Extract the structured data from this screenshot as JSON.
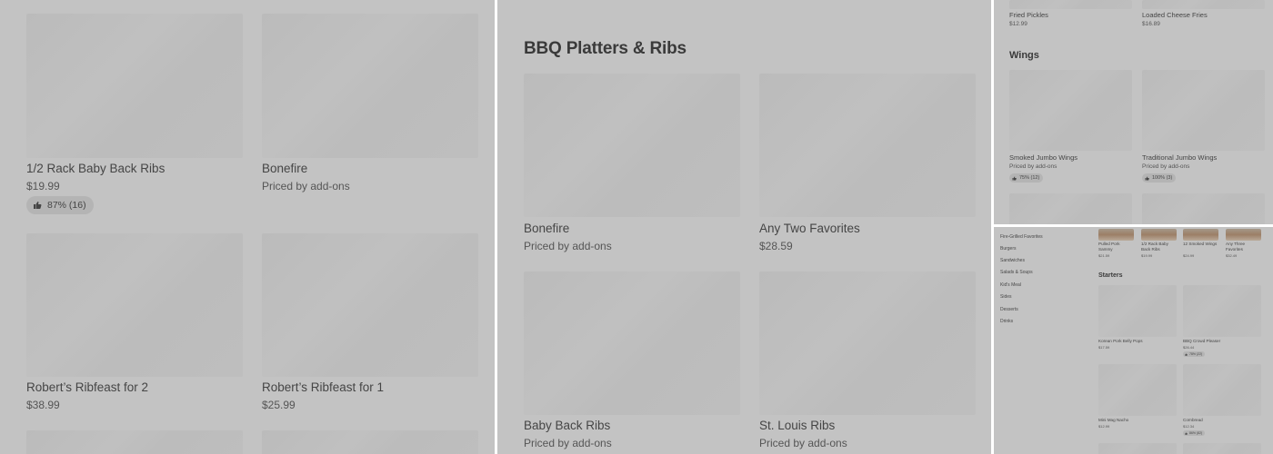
{
  "colors": {
    "background": "#c3c3c3",
    "card": "#bdbdbd",
    "badge": "#b4b4b4",
    "text": "#454545"
  },
  "icons": {
    "rating": "thumbs-up-icon"
  },
  "panel1": {
    "items": [
      {
        "name": "1/2 Rack Baby Back Ribs",
        "price": "$19.99",
        "rating": "87% (16)"
      },
      {
        "name": "Bonefire",
        "price": "Priced by add-ons"
      },
      {
        "name": "Robert’s Ribfeast for 2",
        "price": "$38.99"
      },
      {
        "name": "Robert’s Ribfeast for 1",
        "price": "$25.99"
      }
    ]
  },
  "panel2": {
    "section_title": "BBQ Platters & Ribs",
    "items": [
      {
        "name": "Bonefire",
        "price": "Priced by add-ons"
      },
      {
        "name": "Any Two Favorites",
        "price": "$28.59"
      },
      {
        "name": "Baby Back Ribs",
        "price": "Priced by add-ons"
      },
      {
        "name": "St. Louis Ribs",
        "price": "Priced by add-ons"
      }
    ]
  },
  "panel3": {
    "top_items": [
      {
        "name": "Fried Pickles",
        "price": "$12.99"
      },
      {
        "name": "Loaded Cheese Fries",
        "price": "$16.89"
      }
    ],
    "section_title": "Wings",
    "items": [
      {
        "name": "Smoked Jumbo Wings",
        "price": "Priced by add-ons",
        "rating": "75% (12)"
      },
      {
        "name": "Traditional Jumbo Wings",
        "price": "Priced by add-ons",
        "rating": "100% (3)"
      }
    ]
  },
  "panel4": {
    "sidebar": [
      "Fire-Grilled Favorites",
      "Burgers",
      "Sandwiches",
      "Salads & Soups",
      "Kid's Meal",
      "Sides",
      "Desserts",
      "Drinks"
    ],
    "featured": [
      {
        "name": "Pulled Pork Sammy",
        "price": "$21.59"
      },
      {
        "name": "1/2 Rack Baby Back Ribs",
        "price": "$19.99"
      },
      {
        "name": "12 Smoked Wings",
        "price": "$24.99"
      },
      {
        "name": "Any Three Favorites",
        "price": "$32.49"
      }
    ],
    "section_title": "Starters",
    "items": [
      {
        "name": "Korean Pork Belly Pops",
        "price": "$17.59"
      },
      {
        "name": "BBQ Crowd Pleaser",
        "price": "$26.44",
        "rating": "78% (22)"
      },
      {
        "name": "Mini Mag Nacho",
        "price": "$12.99"
      },
      {
        "name": "Cornbread",
        "price": "$12.34",
        "rating": "86% (82)"
      }
    ]
  }
}
